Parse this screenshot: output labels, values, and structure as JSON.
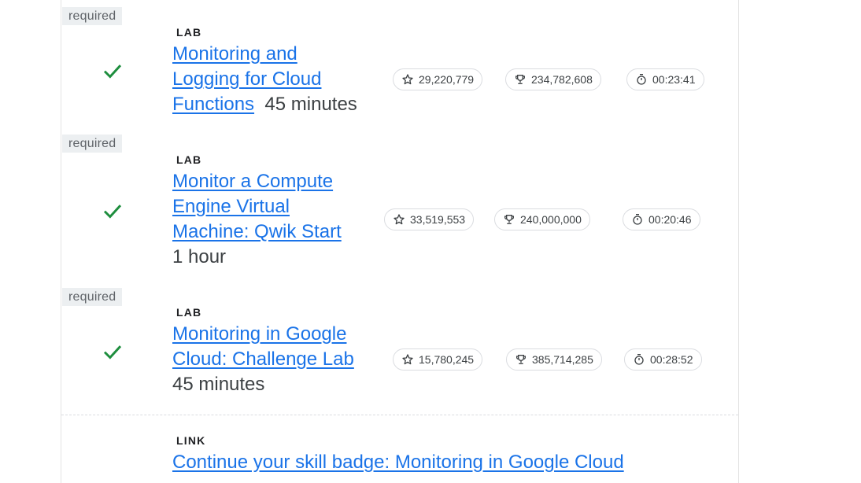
{
  "items": [
    {
      "badge": "required",
      "type": "LAB",
      "title_lines": [
        "Monitoring and",
        "Logging for Cloud",
        "Functions"
      ],
      "duration": "45 minutes",
      "stars": "29,220,779",
      "trophy": "234,782,608",
      "time": "00:23:41"
    },
    {
      "badge": "required",
      "type": "LAB",
      "title_lines": [
        "Monitor a Compute",
        "Engine Virtual",
        "Machine: Qwik Start"
      ],
      "duration": "1 hour",
      "stars": "33,519,553",
      "trophy": "240,000,000",
      "time": "00:20:46"
    },
    {
      "badge": "required",
      "type": "LAB",
      "title_lines": [
        "Monitoring in Google",
        "Cloud: Challenge Lab"
      ],
      "duration": "45 minutes",
      "stars": "15,780,245",
      "trophy": "385,714,285",
      "time": "00:28:52"
    }
  ],
  "link_item": {
    "type": "LINK",
    "title": "Continue your skill badge: Monitoring in Google Cloud"
  },
  "colors": {
    "link": "#1a73e8",
    "check": "#1e8e3e",
    "badge_bg": "#eceff1"
  },
  "icons": [
    "check-icon",
    "star-icon",
    "trophy-icon",
    "timer-icon"
  ]
}
